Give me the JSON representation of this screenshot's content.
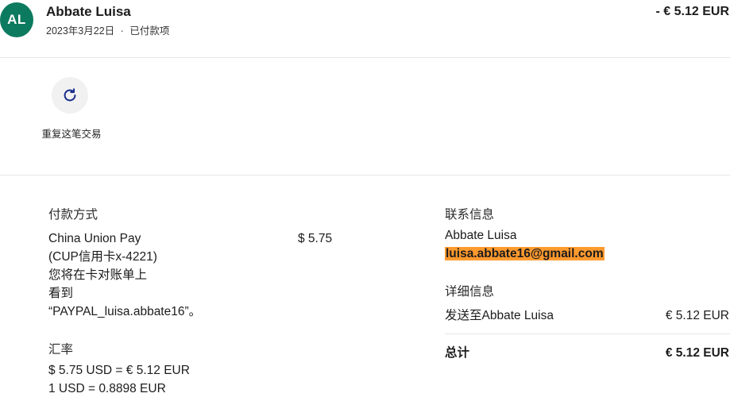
{
  "header": {
    "avatar_initials": "AL",
    "name": "Abbate Luisa",
    "date": "2023年3月22日",
    "separator": "·",
    "status": "已付款项",
    "amount": "- € 5.12 EUR"
  },
  "actions": {
    "repeat_icon": "refresh-icon",
    "repeat_label": "重复这笔交易"
  },
  "payment": {
    "heading": "付款方式",
    "method_lines": [
      "China Union Pay",
      "(CUP信用卡x-4221)",
      "您将在卡对账单上",
      "看到",
      "“PAYPAL_luisa.abbate16”。"
    ],
    "amount": "$ 5.75"
  },
  "exchange": {
    "heading": "汇率",
    "line1": "$ 5.75 USD = € 5.12 EUR",
    "line2": "1 USD = 0.8898 EUR"
  },
  "contact": {
    "heading": "联系信息",
    "name": "Abbate Luisa",
    "email": "luisa.abbate16@gmail.com"
  },
  "details": {
    "heading": "详细信息",
    "sent_to_label": "发送至Abbate Luisa",
    "sent_to_value": "€ 5.12 EUR",
    "total_label": "总计",
    "total_value": "€ 5.12 EUR"
  },
  "colors": {
    "avatar_bg": "#0c7a5f",
    "highlight": "#ff9a2e",
    "icon": "#1a2e8c"
  }
}
